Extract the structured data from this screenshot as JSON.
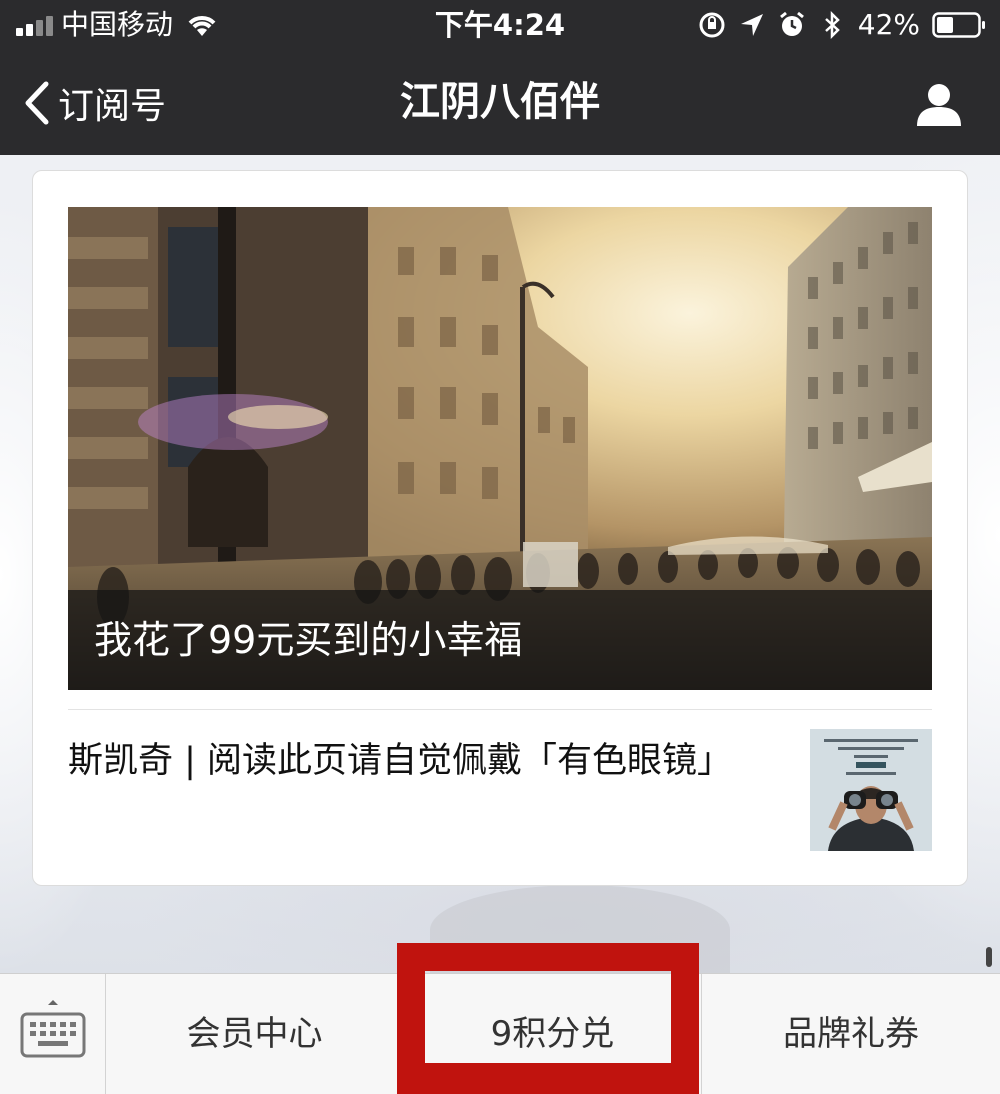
{
  "status_bar": {
    "carrier": "中国移动",
    "time": "下午4:24",
    "battery_percent": "42%",
    "battery_level": 0.42,
    "icons": [
      "signal-icon",
      "wifi-icon",
      "orientation-lock-icon",
      "location-icon",
      "alarm-icon",
      "bluetooth-icon",
      "battery-icon"
    ]
  },
  "nav": {
    "back_label": "订阅号",
    "title": "江阴八佰伴",
    "profile_icon": "person-icon"
  },
  "article_card": {
    "main_title": "我花了99元买到的小幸福",
    "secondary_title": "斯凯奇 | 阅读此页请自觉佩戴「有色眼镜」"
  },
  "menu": {
    "keyboard_icon": "keyboard-icon",
    "items": [
      "会员中心",
      "9积分兑",
      "品牌礼券"
    ]
  },
  "colors": {
    "bar_background": "#2b2b2d",
    "highlight_box": "#c0130e",
    "menu_background": "#f7f7f7"
  }
}
